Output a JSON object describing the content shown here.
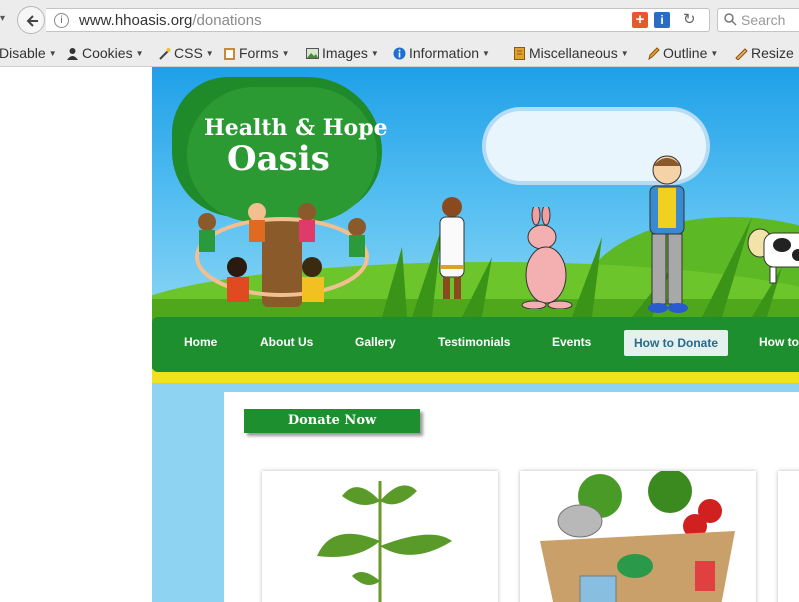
{
  "browser": {
    "url_host": "www.hhoasis.org",
    "url_path": "/donations",
    "search_placeholder": "Search"
  },
  "devtoolbar": {
    "items": [
      {
        "label": "Disable",
        "icon": "none"
      },
      {
        "label": "Cookies",
        "icon": "cookie-person-icon"
      },
      {
        "label": "CSS",
        "icon": "wand-icon"
      },
      {
        "label": "Forms",
        "icon": "clipboard-icon"
      },
      {
        "label": "Images",
        "icon": "image-icon"
      },
      {
        "label": "Information",
        "icon": "info-icon"
      },
      {
        "label": "Miscellaneous",
        "icon": "notebook-icon"
      },
      {
        "label": "Outline",
        "icon": "pencil-icon"
      },
      {
        "label": "Resize",
        "icon": "ruler-icon"
      }
    ]
  },
  "site": {
    "logo_line1": "Health & Hope",
    "logo_line2": "Oasis",
    "nav": [
      {
        "label": "Home"
      },
      {
        "label": "About Us"
      },
      {
        "label": "Gallery"
      },
      {
        "label": "Testimonials"
      },
      {
        "label": "Events"
      },
      {
        "label": "How to Donate",
        "active": true
      },
      {
        "label": "How to"
      }
    ],
    "donate_button": "Donate Now"
  }
}
